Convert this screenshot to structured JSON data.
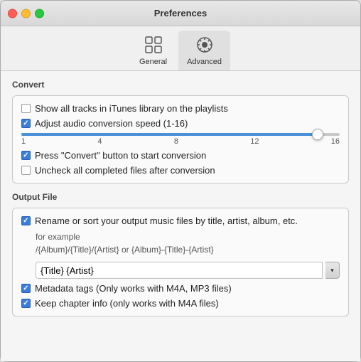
{
  "window": {
    "title": "Preferences"
  },
  "toolbar": {
    "buttons": [
      {
        "id": "general",
        "label": "General",
        "icon": "general"
      },
      {
        "id": "advanced",
        "label": "Advanced",
        "icon": "advanced",
        "active": true
      }
    ]
  },
  "convert_section": {
    "title": "Convert",
    "items": [
      {
        "id": "show_tracks",
        "checked": false,
        "label": "Show all tracks in iTunes library on the playlists"
      },
      {
        "id": "adjust_speed",
        "checked": true,
        "label": "Adjust audio conversion speed (1-16)"
      },
      {
        "id": "press_convert",
        "checked": true,
        "label": "Press \"Convert\" button to start conversion"
      },
      {
        "id": "uncheck_completed",
        "checked": false,
        "label": "Uncheck all completed files after conversion"
      }
    ],
    "slider": {
      "min": 1,
      "max": 16,
      "value": 16,
      "labels": [
        "1",
        "4",
        "8",
        "12",
        "16"
      ]
    }
  },
  "output_section": {
    "title": "Output File",
    "rename_item": {
      "id": "rename_sort",
      "checked": true,
      "label": "Rename or sort your output music files by title, artist, album, etc."
    },
    "example_label": "for example",
    "example_template": "/{Album}/{Title}/{Artist} or {Album}-{Title}-{Artist}",
    "input_value": "{Title} {Artist}",
    "input_placeholder": "{Title} {Artist}",
    "dropdown_arrow": "▾",
    "metadata_item": {
      "id": "metadata",
      "checked": true,
      "label": "Metadata tags (Only works with M4A, MP3 files)"
    },
    "chapter_item": {
      "id": "chapter_info",
      "checked": true,
      "label": "Keep chapter info (only works with  M4A files)"
    }
  }
}
